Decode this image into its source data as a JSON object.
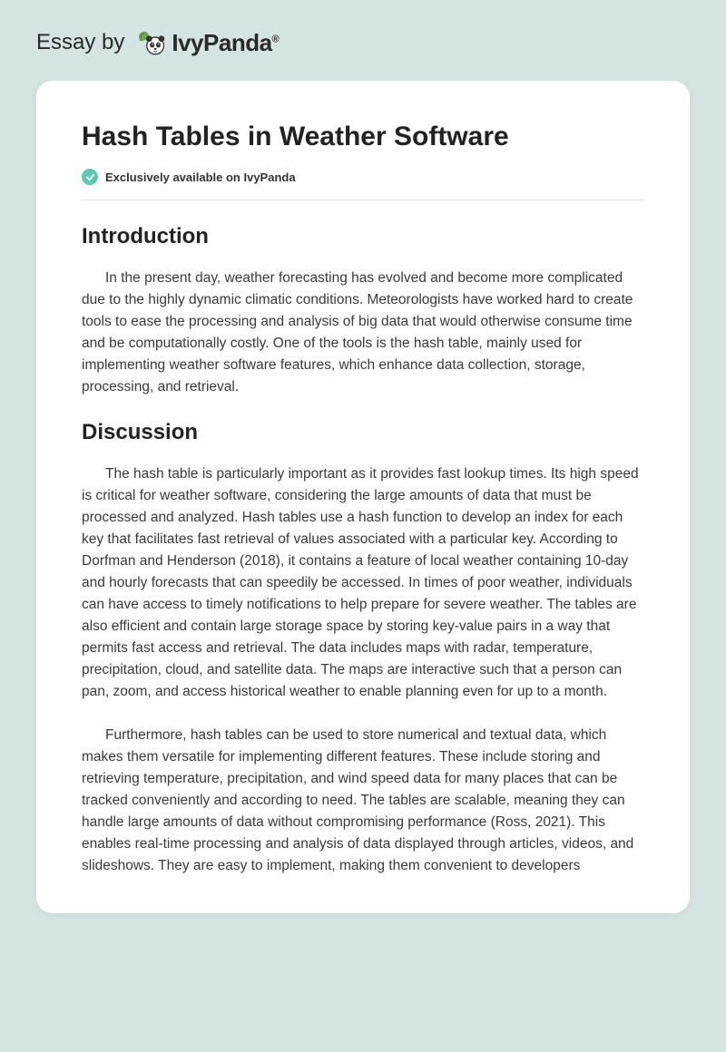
{
  "header": {
    "essay_by": "Essay by",
    "brand_name": "IvyPanda",
    "brand_tm": "®"
  },
  "document": {
    "title": "Hash Tables in Weather Software",
    "exclusive_text": "Exclusively available on IvyPanda",
    "sections": {
      "intro_heading": "Introduction",
      "intro_para": "In the present day, weather forecasting has evolved and become more complicated due to the highly dynamic climatic conditions. Meteorologists have worked hard to create tools to ease the processing and analysis of big data that would otherwise consume time and be computationally costly. One of the tools is the hash table, mainly used for implementing weather software features, which enhance data collection, storage, processing, and retrieval.",
      "discussion_heading": "Discussion",
      "discussion_para1": "The hash table is particularly important as it provides fast lookup times. Its high speed is critical for weather software, considering the large amounts of data that must be processed and analyzed. Hash tables use a hash function to develop an index for each key that facilitates fast retrieval of values associated with a particular key. According to Dorfman and Henderson (2018), it contains a feature of local weather containing 10-day and hourly forecasts that can speedily be accessed. In times of poor weather, individuals can have access to timely notifications to help prepare for severe weather. The tables are also efficient and contain large storage space by storing key-value pairs in a way that permits fast access and retrieval. The data includes maps with radar, temperature, precipitation, cloud, and satellite data. The maps are interactive such that a person can pan, zoom, and access historical weather to enable planning even for up to a month.",
      "discussion_para2": "Furthermore, hash tables can be used to store numerical and textual data, which makes them versatile for implementing different features. These include storing and retrieving temperature, precipitation, and wind speed data for many places that can be tracked conveniently and according to need. The tables are scalable, meaning they can handle large amounts of data without compromising performance (Ross, 2021). This enables real-time processing and analysis of data displayed through articles, videos, and slideshows. They are easy to implement, making them convenient to developers"
    }
  }
}
